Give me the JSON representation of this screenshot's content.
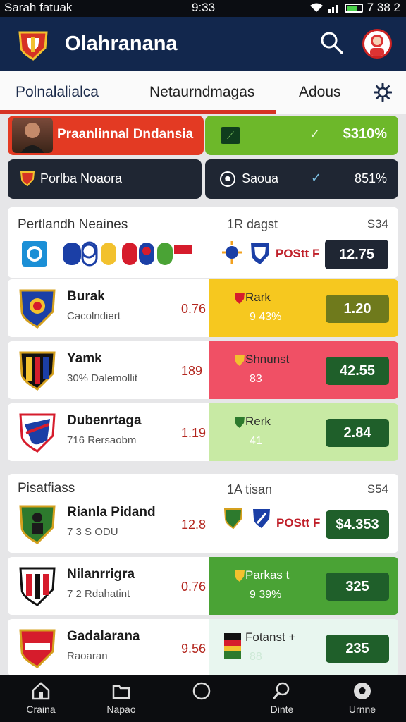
{
  "status_bar": {
    "carrier": "Sarah fatuak",
    "time": "9:33",
    "right_text": "7 38 2"
  },
  "app": {
    "title": "Olahranana"
  },
  "tabs": [
    {
      "label": "Polnalalialca",
      "active": true
    },
    {
      "label": "Netaurndmagas",
      "active": false
    },
    {
      "label": "Adous",
      "active": false
    }
  ],
  "promo": {
    "red_label": "Praanlinnal Dndansia",
    "green_value": "$310%",
    "dark_left_label": "Porlba Noaora",
    "dark_right_label": "Saoua",
    "dark_right_value": "851%"
  },
  "section1": {
    "title": "Pertlandh Neaines",
    "mid": "1R dagst",
    "right": "S34",
    "odds": "12.75",
    "vs_label": "POStt F"
  },
  "section2": {
    "title": "Pisatfiass",
    "mid": "1A tisan",
    "right": "S54"
  },
  "matches": [
    {
      "team": "Burak",
      "sub": "Cacolndiert",
      "mid": "0.76",
      "right_label": "Rark",
      "right_sub": "9 43%",
      "odds": "1.20",
      "panel_color": "#f6c81f",
      "odds_color": "#6f7a1c"
    },
    {
      "team": "Yamk",
      "sub": "30% Dalemollit",
      "mid": "189",
      "right_label": "Shnunst",
      "right_sub": "83",
      "odds": "42.55",
      "panel_color": "#f05065",
      "odds_color": "#1f5f2a"
    },
    {
      "team": "Dubenrtaga",
      "sub": "716  Rersaobm",
      "mid": "1.19",
      "right_label": "Rerk",
      "right_sub": "41",
      "odds": "2.84",
      "panel_color": "#c8eaa4",
      "odds_color": "#1f5f2a"
    },
    {
      "team": "Rianla Pidand",
      "sub": "7 3 S ODU",
      "mid": "12.8",
      "right_label": "POStt F",
      "right_sub": "",
      "odds": "$4.353",
      "panel_color": "#ffffff",
      "odds_color": "#1f5f2a"
    },
    {
      "team": "Nilanrrigra",
      "sub": "7 2  Rdahatint",
      "mid": "0.76",
      "right_label": "Parkas t",
      "right_sub": "9 39%",
      "odds": "325",
      "panel_color": "#4aa335",
      "odds_color": "#1f5f2a"
    },
    {
      "team": "Gadalarana",
      "sub": "Raoaran",
      "mid": "9.56",
      "right_label": "Fotanst +",
      "right_sub": "88",
      "odds": "235",
      "panel_color": "#e8f6ef",
      "odds_color": "#1f5f2a"
    }
  ],
  "bottom_nav": [
    {
      "label": "Craina",
      "icon": "home-icon"
    },
    {
      "label": "Napao",
      "icon": "folder-icon"
    },
    {
      "label": "",
      "icon": "circle-icon"
    },
    {
      "label": "Dinte",
      "icon": "search-icon"
    },
    {
      "label": "Urnne",
      "icon": "ball-icon"
    }
  ],
  "colors": {
    "appbar": "#12274d",
    "accent_red": "#d63324",
    "dark": "#1f2633"
  }
}
